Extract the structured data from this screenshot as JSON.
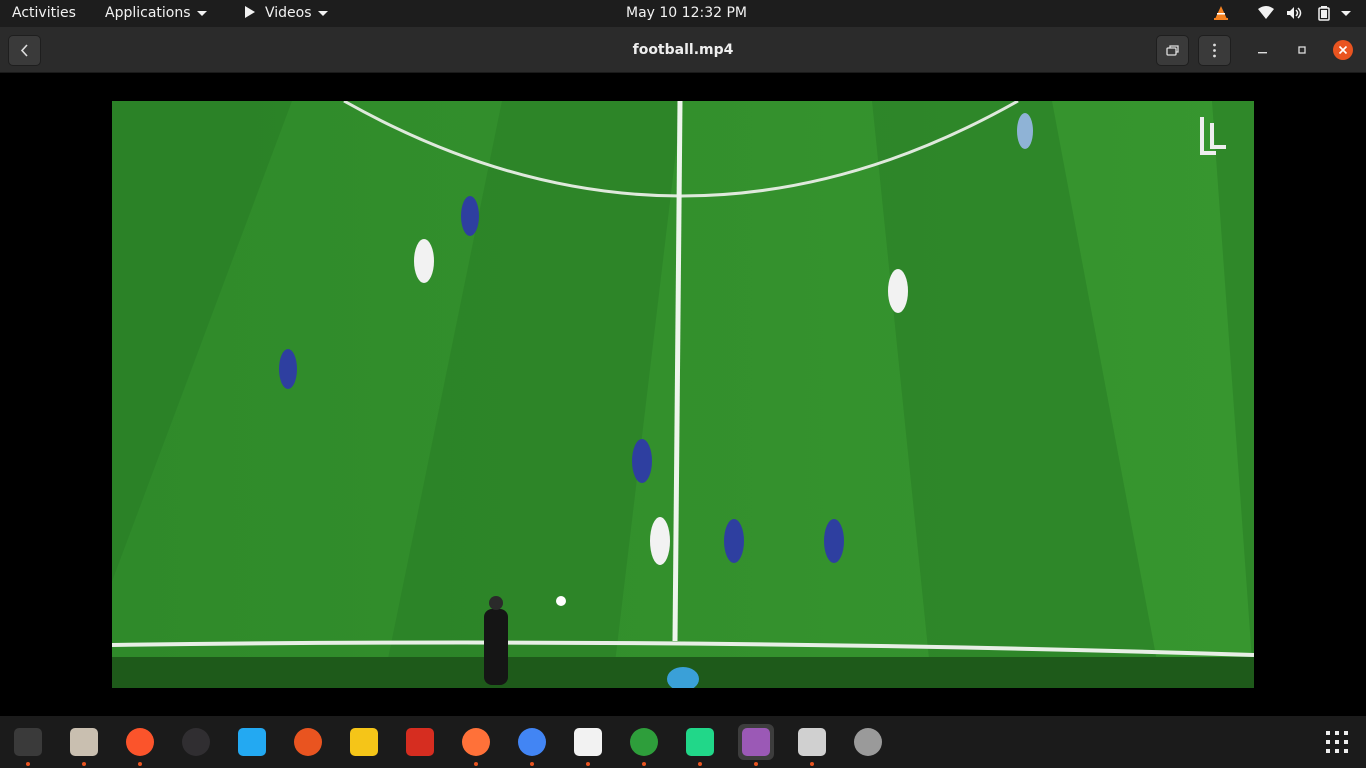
{
  "topbar": {
    "activities": "Activities",
    "applications": "Applications",
    "app_menu": "Videos",
    "datetime": "May 10  12:32 PM"
  },
  "headerbar": {
    "title": "football.mp4"
  },
  "video": {
    "watermark_icon": "ll-logo-watermark"
  },
  "dock": {
    "items": [
      {
        "name": "terminal",
        "icon": "terminal-icon",
        "color": "#3a3a3a",
        "running": true
      },
      {
        "name": "files",
        "icon": "files-icon",
        "color": "#c9bfb0",
        "running": true
      },
      {
        "name": "brave",
        "icon": "brave-icon",
        "color": "#fb542b",
        "running": true
      },
      {
        "name": "obs",
        "icon": "obs-icon",
        "color": "#302e31",
        "running": false
      },
      {
        "name": "vscode",
        "icon": "vscode-icon",
        "color": "#23a9f2",
        "running": false
      },
      {
        "name": "app-orange",
        "icon": "app-icon",
        "color": "#e95420",
        "running": false
      },
      {
        "name": "rhythmbox",
        "icon": "rhythmbox-icon",
        "color": "#f5c518",
        "running": false
      },
      {
        "name": "app-blocks",
        "icon": "blocks-icon",
        "color": "#d62d20",
        "running": false
      },
      {
        "name": "firefox",
        "icon": "firefox-icon",
        "color": "#ff7139",
        "running": true
      },
      {
        "name": "chrome",
        "icon": "chrome-icon",
        "color": "#4285f4",
        "running": true
      },
      {
        "name": "document-viewer",
        "icon": "document-icon",
        "color": "#f2f2f2",
        "running": true
      },
      {
        "name": "app-ring",
        "icon": "ring-icon",
        "color": "#2e9e3b",
        "running": true
      },
      {
        "name": "pycharm",
        "icon": "pycharm-icon",
        "color": "#21d789",
        "running": true
      },
      {
        "name": "videos",
        "icon": "videos-icon",
        "color": "#9b59b6",
        "running": true
      },
      {
        "name": "image-viewer",
        "icon": "image-viewer-icon",
        "color": "#d0d0d0",
        "running": true
      },
      {
        "name": "disc",
        "icon": "disc-icon",
        "color": "#9a9a9a",
        "running": false
      }
    ]
  }
}
